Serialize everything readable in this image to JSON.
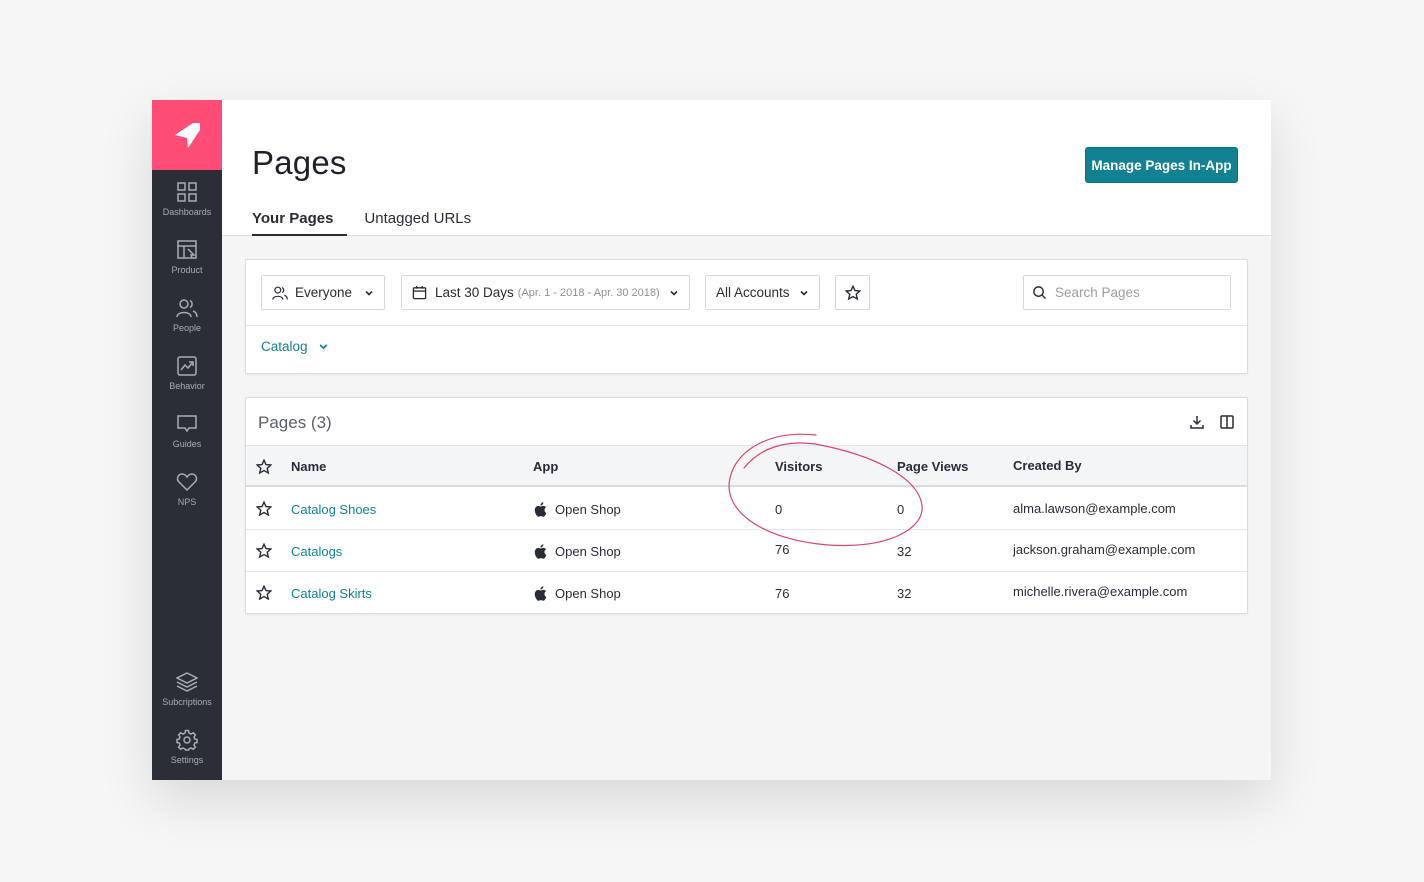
{
  "sidebar": {
    "items": [
      {
        "label": "Dashboards",
        "icon": "dashboards-icon"
      },
      {
        "label": "Product",
        "icon": "product-icon"
      },
      {
        "label": "People",
        "icon": "people-icon"
      },
      {
        "label": "Behavior",
        "icon": "behavior-icon"
      },
      {
        "label": "Guides",
        "icon": "guides-icon"
      },
      {
        "label": "NPS",
        "icon": "heart-icon"
      }
    ],
    "bottom_items": [
      {
        "label": "Subcriptions",
        "icon": "layers-icon"
      },
      {
        "label": "Settings",
        "icon": "gear-icon"
      }
    ]
  },
  "header": {
    "title": "Pages",
    "manage_button": "Manage Pages In-App",
    "tabs": [
      {
        "label": "Your Pages",
        "active": true
      },
      {
        "label": "Untagged URLs",
        "active": false
      }
    ]
  },
  "filters": {
    "segment": "Everyone",
    "date_range": "Last 30 Days",
    "date_detail": "(Apr. 1 - 2018 - Apr. 30 2018)",
    "accounts": "All Accounts",
    "search_placeholder": "Search Pages",
    "group": "Catalog"
  },
  "table": {
    "title": "Pages (3)",
    "columns": [
      "Name",
      "App",
      "Visitors",
      "Page Views",
      "Created By"
    ],
    "rows": [
      {
        "name": "Catalog Shoes",
        "app": "Open Shop",
        "visitors": "0",
        "page_views": "0",
        "created_by": "alma.lawson@example.com"
      },
      {
        "name": "Catalogs",
        "app": "Open Shop",
        "visitors": "76",
        "page_views": "32",
        "created_by": "jackson.graham@example.com"
      },
      {
        "name": "Catalog Skirts",
        "app": "Open Shop",
        "visitors": "76",
        "page_views": "32",
        "created_by": "michelle.rivera@example.com"
      }
    ]
  },
  "colors": {
    "brand_pink": "#fd4d76",
    "accent_teal": "#128293",
    "sidebar_dark": "#2b2e36",
    "annotation_red": "#d9456a"
  }
}
